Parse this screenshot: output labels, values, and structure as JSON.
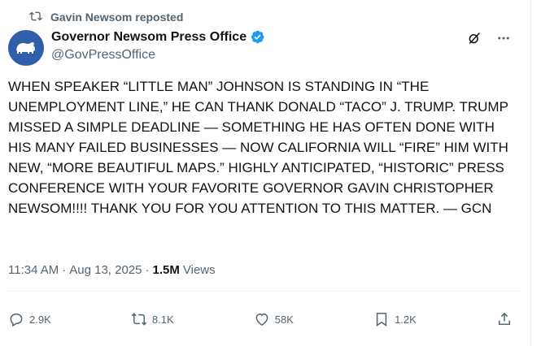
{
  "repost": {
    "label": "Gavin Newsom reposted"
  },
  "author": {
    "display_name": "Governor Newsom Press Office",
    "handle": "@GovPressOffice"
  },
  "post": {
    "text": "WHEN SPEAKER “LITTLE MAN” JOHNSON IS STANDING IN “THE UNEMPLOYMENT LINE,” HE CAN THANK DONALD “TACO” J. TRUMP. TRUMP MISSED A SIMPLE DEADLINE — SOMETHING HE HAS OFTEN DONE WITH HIS MANY FAILED BUSINESSES — NOW CALIFORNIA WILL “FIRE” HIM WITH NEW, “MORE BEAUTIFUL MAPS.” HIGHLY ANTICIPATED, “HISTORIC” PRESS CONFERENCE WITH YOUR FAVORITE GOVERNOR GAVIN CHRISTOPHER NEWSOM!!!! THANK YOU FOR YOU ATTENTION TO THIS MATTER. — GCN",
    "time": "11:34 AM",
    "separator": "·",
    "date": "Aug 13, 2025",
    "views_count": "1.5M",
    "views_label": "Views"
  },
  "actions": {
    "replies": "2.9K",
    "reposts": "8.1K",
    "likes": "58K",
    "bookmarks": "1.2K"
  },
  "colors": {
    "text": "#0f1419",
    "secondary": "#536471",
    "verified": "#1d9bf0",
    "avatar_bg": "#2f5fa8"
  },
  "icons": [
    "repost-icon",
    "bear-logo-icon",
    "verified-badge-icon",
    "grok-icon",
    "more-icon",
    "reply-icon",
    "like-icon",
    "bookmark-icon",
    "share-icon"
  ]
}
